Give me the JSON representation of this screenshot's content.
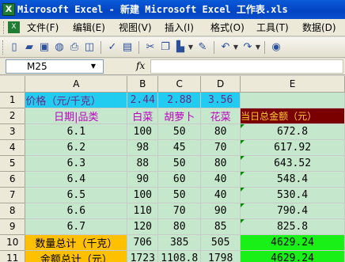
{
  "window": {
    "title": "Microsoft Excel - 新建 Microsoft Excel 工作表.xls",
    "icon": "excel-icon"
  },
  "menu": {
    "items": [
      "文件(F)",
      "编辑(E)",
      "视图(V)",
      "插入(I)",
      "格式(O)",
      "工具(T)",
      "数据(D)"
    ]
  },
  "toolbar": {
    "icons": [
      "new-icon",
      "open-icon",
      "save-icon",
      "permission-icon",
      "print-icon",
      "print-preview-icon",
      "spelling-icon",
      "research-icon",
      "cut-icon",
      "copy-icon",
      "paste-icon",
      "format-painter-icon",
      "undo-icon",
      "redo-icon",
      "help-icon"
    ]
  },
  "formula_bar": {
    "name_box": "M25",
    "fx_label": "fx",
    "formula": ""
  },
  "sheet": {
    "columns": [
      "A",
      "B",
      "C",
      "D",
      "E"
    ],
    "rows": [
      {
        "num": "1",
        "cells": [
          "价格（元/千克）",
          "2.44",
          "2.88",
          "3.56",
          ""
        ]
      },
      {
        "num": "2",
        "cells": [
          "日期|品类",
          "白菜",
          "胡萝卜",
          "花菜",
          "当日总金额（元）"
        ]
      },
      {
        "num": "3",
        "cells": [
          "6.1",
          "100",
          "50",
          "80",
          "672.8"
        ]
      },
      {
        "num": "4",
        "cells": [
          "6.2",
          "98",
          "45",
          "70",
          "617.92"
        ]
      },
      {
        "num": "5",
        "cells": [
          "6.3",
          "88",
          "50",
          "80",
          "643.52"
        ]
      },
      {
        "num": "6",
        "cells": [
          "6.4",
          "90",
          "60",
          "40",
          "548.4"
        ]
      },
      {
        "num": "7",
        "cells": [
          "6.5",
          "100",
          "50",
          "40",
          "530.4"
        ]
      },
      {
        "num": "8",
        "cells": [
          "6.6",
          "110",
          "70",
          "90",
          "790.4"
        ]
      },
      {
        "num": "9",
        "cells": [
          "6.7",
          "120",
          "80",
          "85",
          "825.8"
        ]
      },
      {
        "num": "10",
        "cells": [
          "数量总计（千克）",
          "706",
          "385",
          "505",
          "4629.24"
        ]
      },
      {
        "num": "11",
        "cells": [
          "金额总计（元）",
          "1723",
          "1108.8",
          "1798",
          "4629.24"
        ]
      }
    ]
  },
  "colors": {
    "cyan": "#22ccf0",
    "dark_red": "#7a0000",
    "orange": "#ffc000",
    "green": "#18f018",
    "grid_bg": "#c5e8cd",
    "magenta_text": "#c000c0"
  }
}
